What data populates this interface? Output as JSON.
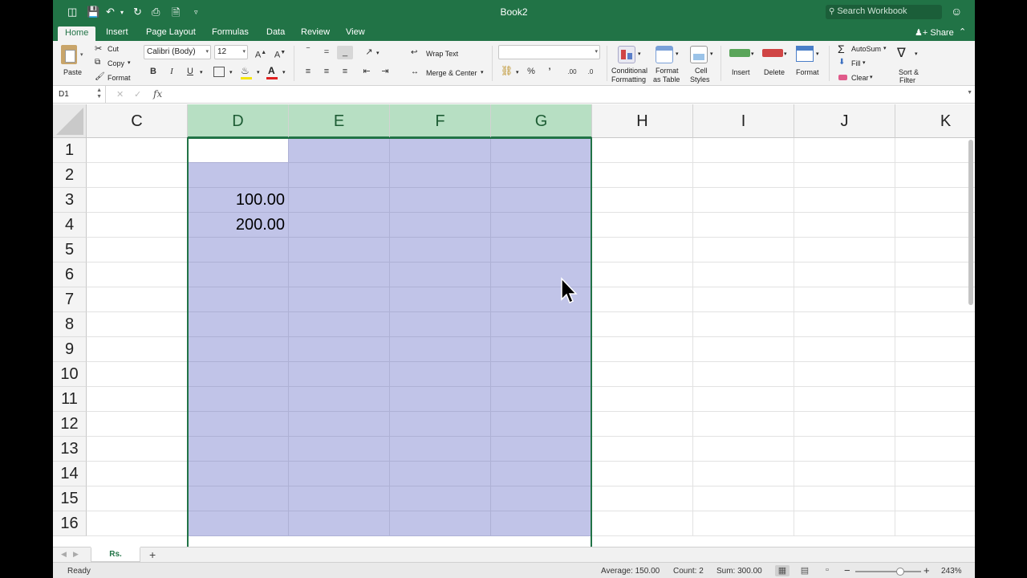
{
  "window": {
    "title": "Book2"
  },
  "search": {
    "placeholder": "Search Workbook"
  },
  "tabs": [
    "Home",
    "Insert",
    "Page Layout",
    "Formulas",
    "Data",
    "Review",
    "View"
  ],
  "share_label": "Share",
  "ribbon": {
    "paste": "Paste",
    "cut": "Cut",
    "copy": "Copy",
    "format_painter": "Format",
    "font_name": "Calibri (Body)",
    "font_size": "12",
    "bold": "B",
    "italic": "I",
    "underline": "U",
    "wrap_text": "Wrap Text",
    "merge_center": "Merge & Center",
    "number_format": "",
    "percent": "%",
    "comma": "’",
    "inc_decimal": ".00",
    "dec_decimal": ".0",
    "conditional_formatting_1": "Conditional",
    "conditional_formatting_2": "Formatting",
    "format_as_table_1": "Format",
    "format_as_table_2": "as Table",
    "cell_styles_1": "Cell",
    "cell_styles_2": "Styles",
    "insert": "Insert",
    "delete": "Delete",
    "format": "Format",
    "autosum": "AutoSum",
    "fill": "Fill",
    "clear": "Clear",
    "sort_filter_1": "Sort &",
    "sort_filter_2": "Filter"
  },
  "formula_bar": {
    "name_box": "D1",
    "fx": "fx",
    "content": ""
  },
  "columns": [
    "C",
    "D",
    "E",
    "F",
    "G",
    "H",
    "I",
    "J",
    "K"
  ],
  "selected_columns": [
    "D",
    "E",
    "F",
    "G"
  ],
  "rows": [
    "1",
    "2",
    "3",
    "4",
    "5",
    "6",
    "7",
    "8",
    "9",
    "10",
    "11",
    "12",
    "13",
    "14",
    "15",
    "16"
  ],
  "cells": {
    "D3": "100.00",
    "D4": "200.00"
  },
  "active_cell": "D1",
  "sheet_tab": "Rs.",
  "status": {
    "ready": "Ready",
    "average": "Average: 150.00",
    "count": "Count: 2",
    "sum": "Sum: 300.00",
    "zoom": "243%"
  },
  "colors": {
    "accent": "#217346",
    "selection": "#c1c4e8",
    "header_selected": "#b7dfc3"
  }
}
